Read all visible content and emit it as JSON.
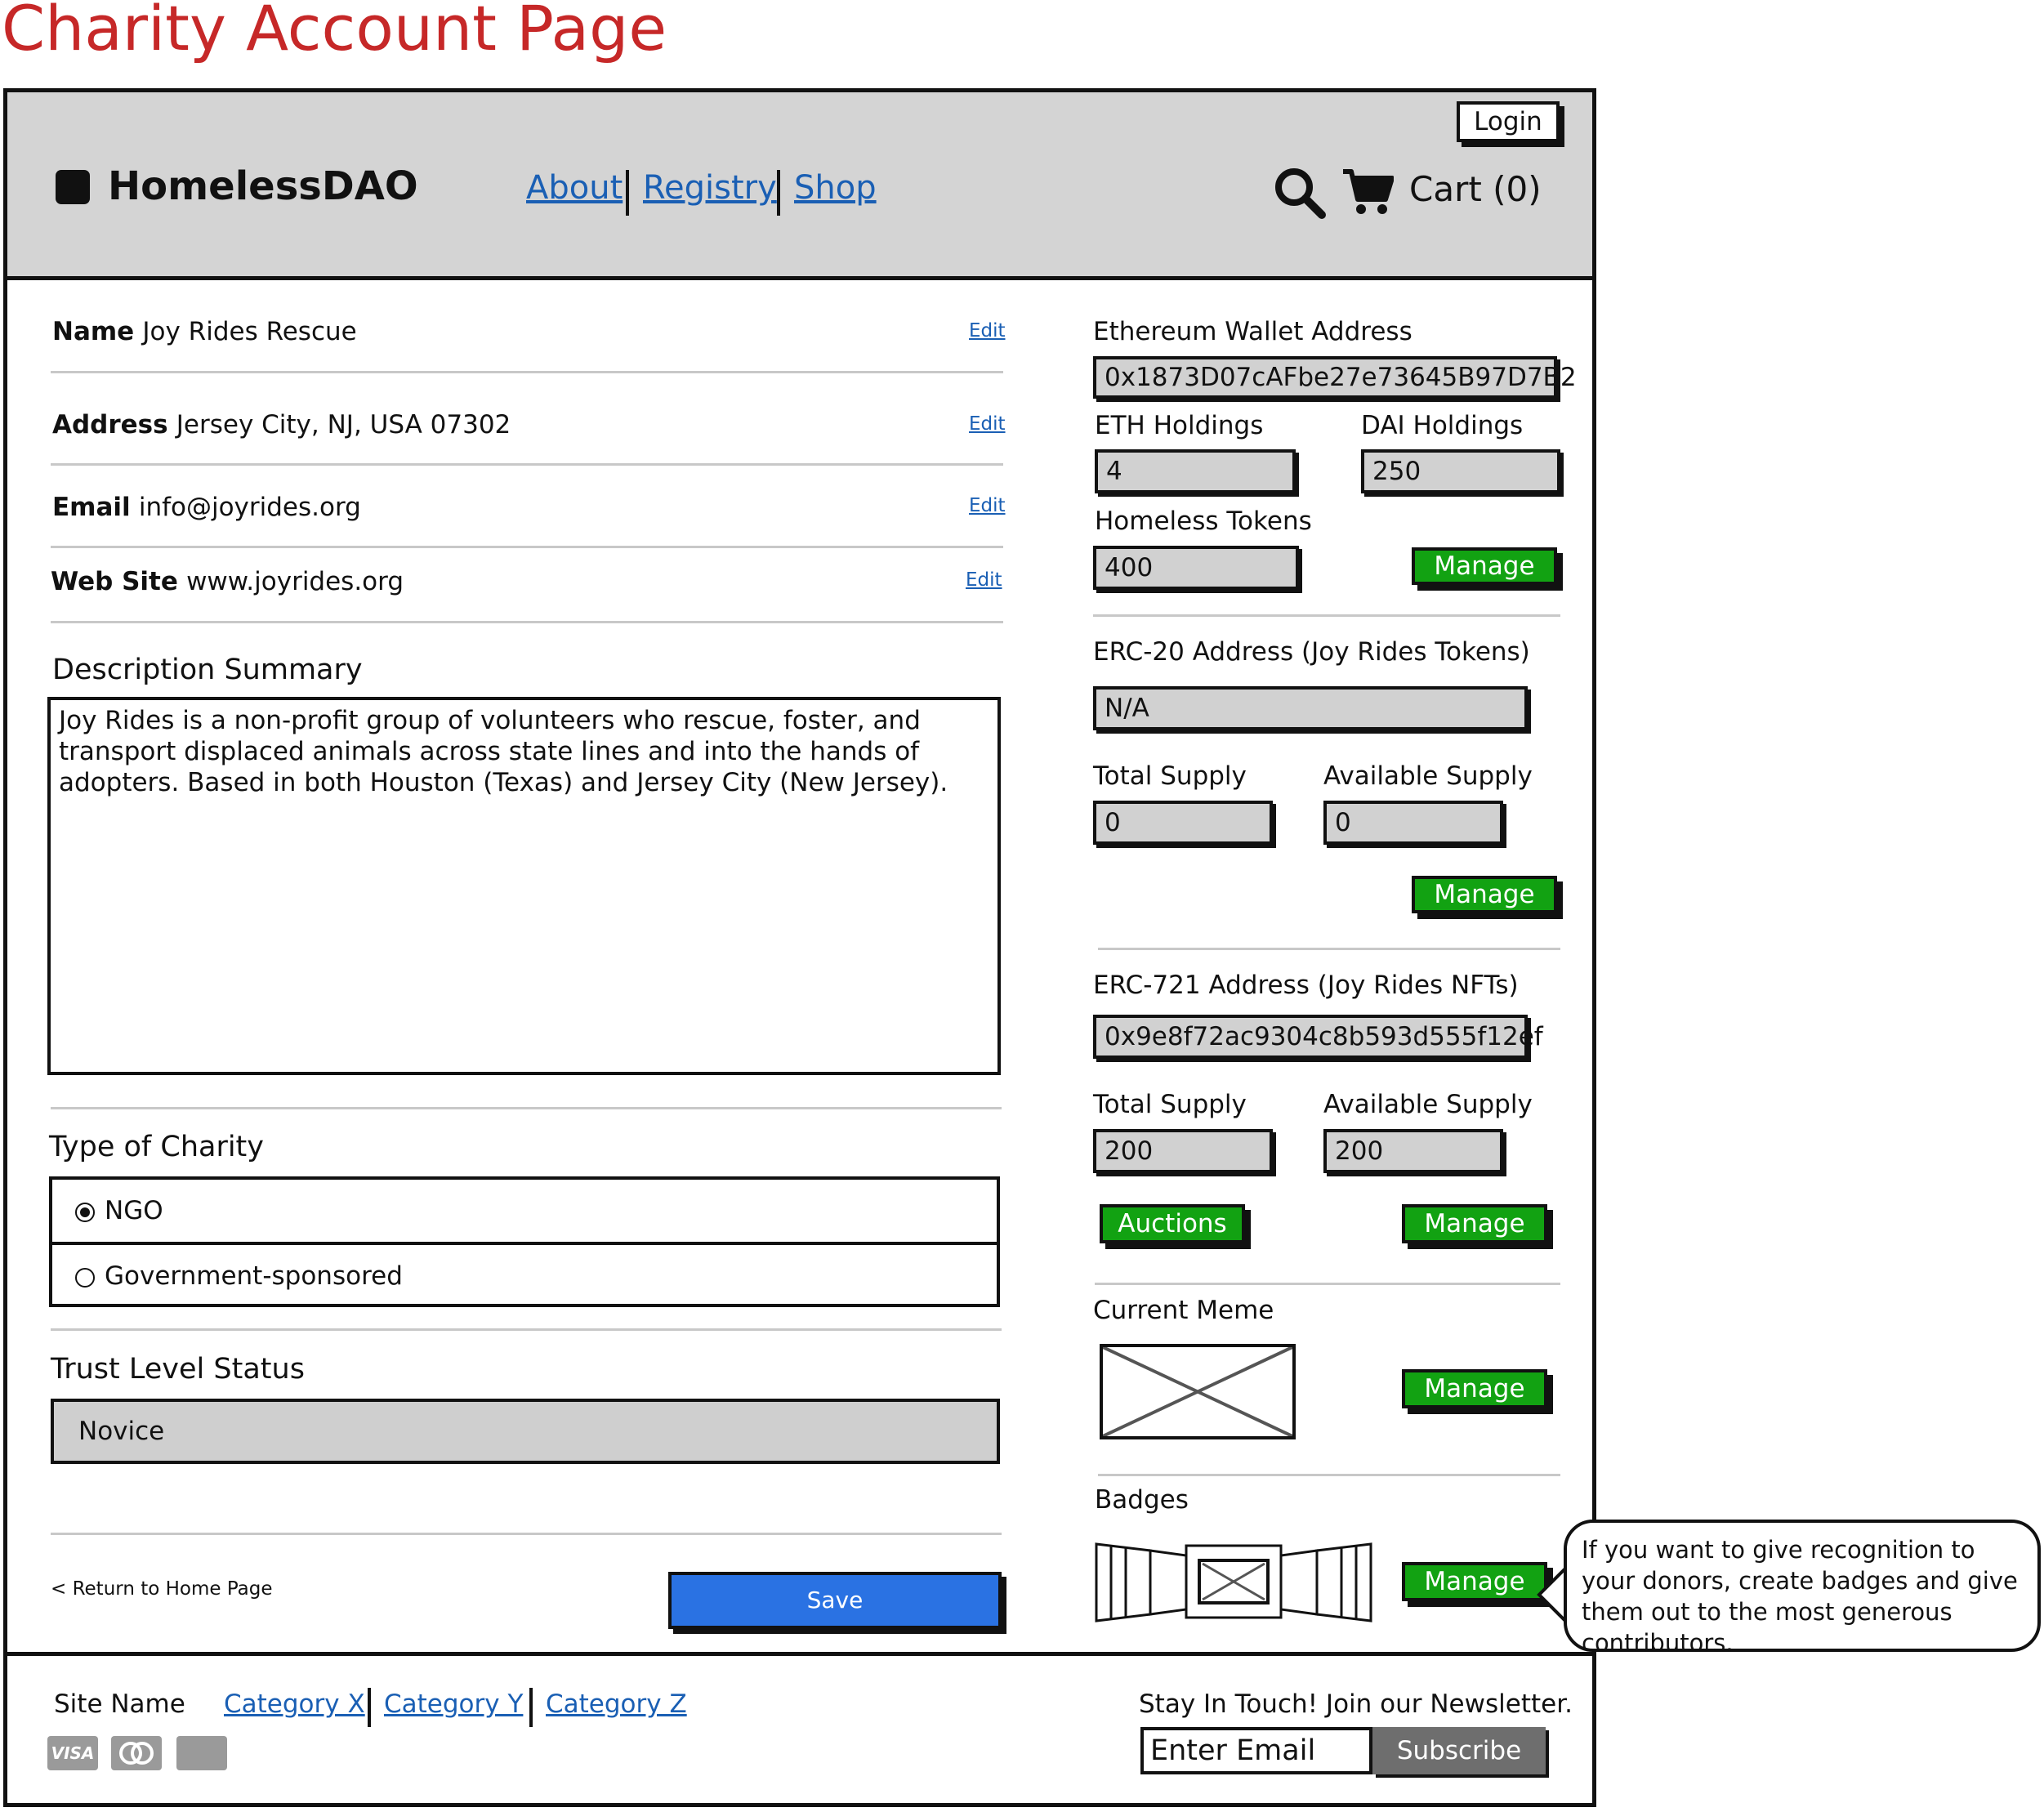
{
  "page_title": "Charity Account Page",
  "header": {
    "login_label": "Login",
    "brand": "HomelessDAO",
    "nav": [
      "About",
      "Registry",
      "Shop"
    ],
    "cart_label": "Cart (0)"
  },
  "profile": {
    "name_label": "Name",
    "name_value": "Joy Rides Rescue",
    "address_label": "Address",
    "address_value": "Jersey City, NJ, USA 07302",
    "email_label": "Email",
    "email_value": "info@joyrides.org",
    "website_label": "Web Site",
    "website_value": "www.joyrides.org",
    "edit_label": "Edit"
  },
  "description": {
    "title": "Description Summary",
    "text": "Joy Rides is a non-profit group of volunteers who rescue, foster, and transport displaced animals across state lines and into the hands of adopters.  Based in both Houston (Texas) and Jersey City (New Jersey)."
  },
  "charity_type": {
    "title": "Type of Charity",
    "options": [
      "NGO",
      "Government-sponsored"
    ],
    "selected": "NGO"
  },
  "trust": {
    "title": "Trust Level Status",
    "value": "Novice"
  },
  "actions": {
    "return_label": "< Return to Home Page",
    "save_label": "Save"
  },
  "wallet": {
    "eth_address_label": "Ethereum Wallet Address",
    "eth_address": "0x1873D07cAFbe27e73645B97D7B2",
    "eth_holdings_label": "ETH Holdings",
    "eth_holdings": "4",
    "dai_holdings_label": "DAI Holdings",
    "dai_holdings": "250",
    "homeless_tokens_label": "Homeless Tokens",
    "homeless_tokens": "400",
    "manage_label": "Manage"
  },
  "erc20": {
    "address_label": "ERC-20 Address (Joy Rides Tokens)",
    "address": "N/A",
    "total_supply_label": "Total Supply",
    "total_supply": "0",
    "available_supply_label": "Available Supply",
    "available_supply": "0",
    "manage_label": "Manage"
  },
  "erc721": {
    "address_label": "ERC-721 Address (Joy Rides NFTs)",
    "address": "0x9e8f72ac9304c8b593d555f12ef",
    "total_supply_label": "Total Supply",
    "total_supply": "200",
    "available_supply_label": "Available Supply",
    "available_supply": "200",
    "auctions_label": "Auctions",
    "manage_label": "Manage"
  },
  "meme": {
    "label": "Current Meme",
    "manage_label": "Manage"
  },
  "badges": {
    "label": "Badges",
    "manage_label": "Manage",
    "callout": "If you want to give recognition to your donors, create badges and give them out to the most generous contributors."
  },
  "footer": {
    "site_name": "Site Name",
    "categories": [
      "Category X",
      "Category Y",
      "Category Z"
    ],
    "newsletter_label": "Stay In Touch! Join our Newsletter.",
    "email_placeholder": "Enter Email",
    "subscribe_label": "Subscribe",
    "cards": [
      "VISA",
      "mastercard",
      "AMERICAN EXPRESS"
    ]
  },
  "colors": {
    "title_red": "#c62828",
    "link_blue": "#1a5fb4",
    "save_blue": "#2a72e3",
    "manage_green": "#12a212",
    "header_gray": "#d4d4d4",
    "field_gray": "#d1d1d1"
  },
  "icons": [
    "logo-square-icon",
    "search-icon",
    "cart-icon",
    "image-placeholder-icon",
    "badge-ribbon-icon",
    "visa-icon",
    "mastercard-icon",
    "amex-icon"
  ]
}
